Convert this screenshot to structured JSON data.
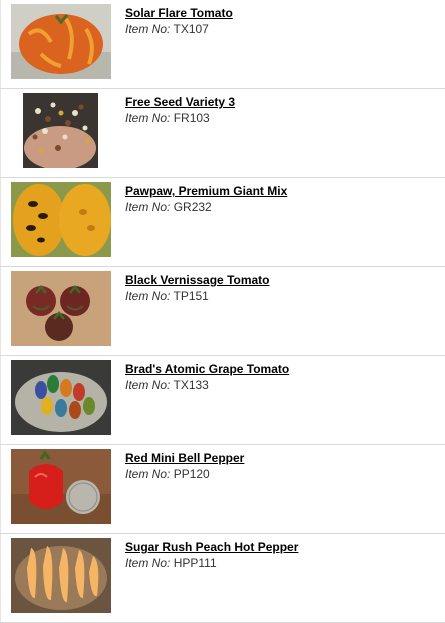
{
  "item_label": "Item No:",
  "products": [
    {
      "title": "Solar Flare Tomato",
      "item_no": "TX107",
      "image": "striped-orange-tomato"
    },
    {
      "title": "Free Seed Variety 3",
      "item_no": "FR103",
      "image": "mixed-seeds-in-hand"
    },
    {
      "title": "Pawpaw, Premium Giant Mix",
      "item_no": "GR232",
      "image": "cut-pawpaw-fruit"
    },
    {
      "title": "Black Vernissage Tomato",
      "item_no": "TP151",
      "image": "dark-tomatoes"
    },
    {
      "title": "Brad's Atomic Grape Tomato",
      "item_no": "TX133",
      "image": "multicolor-grape-tomatoes"
    },
    {
      "title": "Red Mini Bell Pepper",
      "item_no": "PP120",
      "image": "red-pepper-with-coin"
    },
    {
      "title": "Sugar Rush Peach Hot Pepper",
      "item_no": "HPP111",
      "image": "peach-hot-peppers"
    }
  ]
}
